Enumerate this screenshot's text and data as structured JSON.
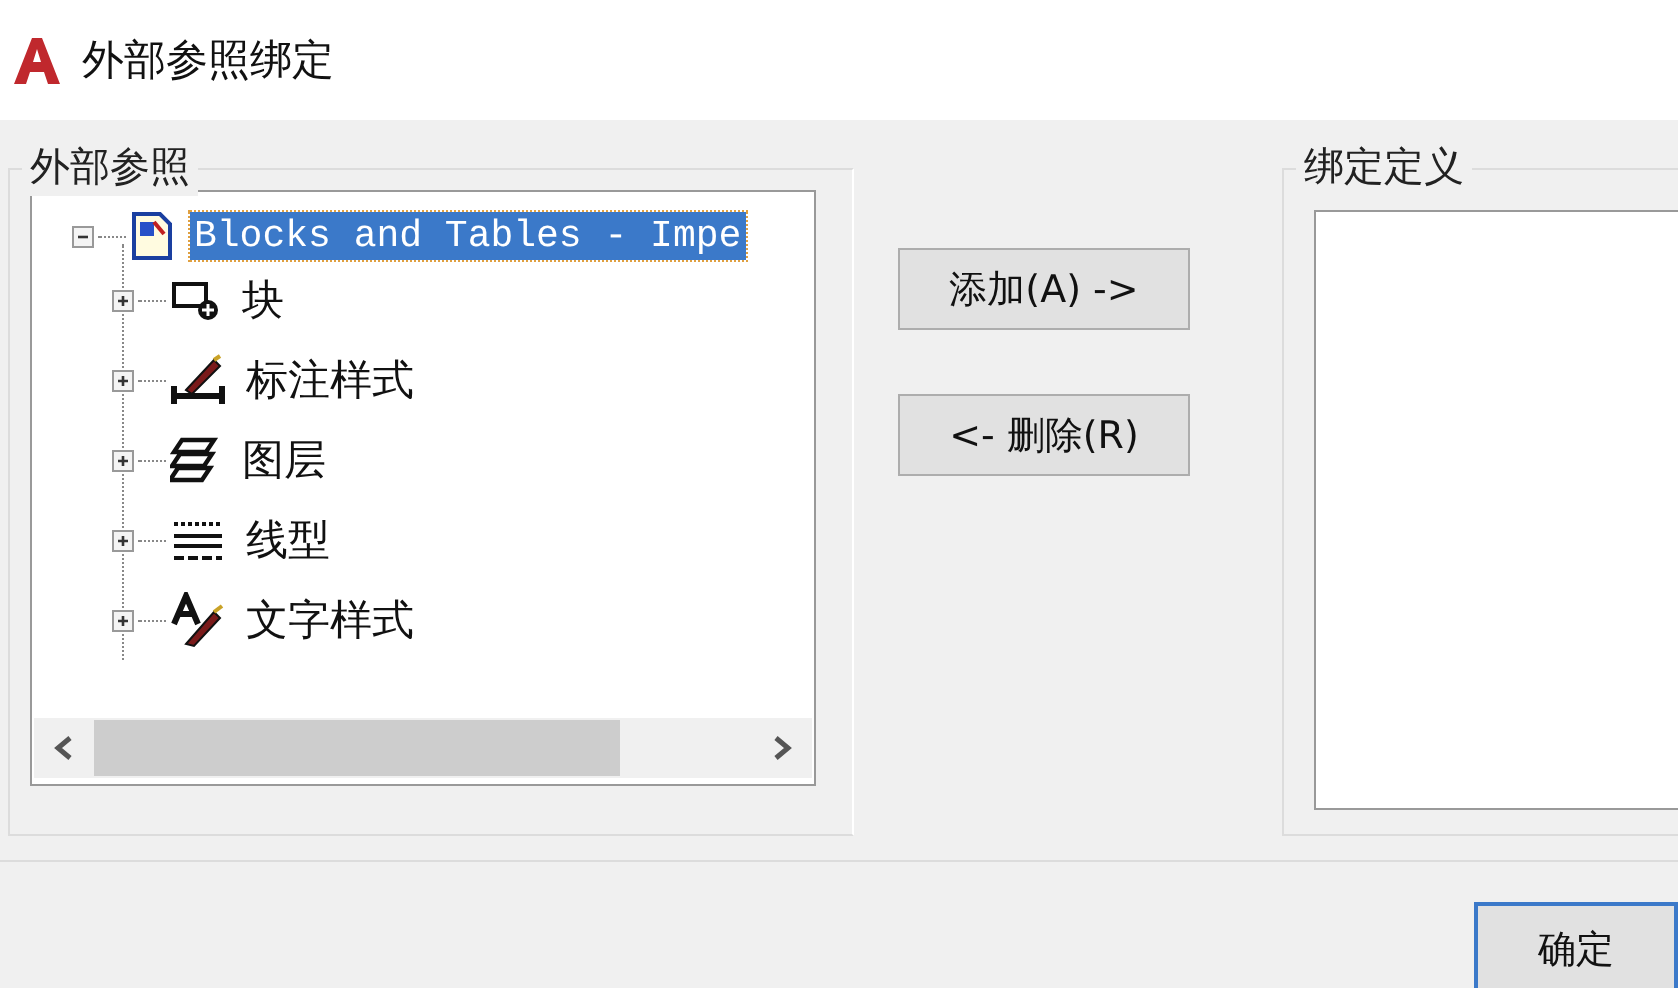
{
  "window": {
    "title": "外部参照绑定"
  },
  "xrefs": {
    "label": "外部参照",
    "tree": {
      "label": "Blocks and Tables - Impe",
      "expanded": true,
      "selected": true,
      "children": [
        {
          "label": "块",
          "kind": "block",
          "expanded": false,
          "selected": false
        },
        {
          "label": "标注样式",
          "kind": "dimstyle",
          "expanded": false,
          "selected": false
        },
        {
          "label": "图层",
          "kind": "layer",
          "expanded": false,
          "selected": false
        },
        {
          "label": "线型",
          "kind": "linetype",
          "expanded": false,
          "selected": false
        },
        {
          "label": "文字样式",
          "kind": "textstyle",
          "expanded": false,
          "selected": false
        }
      ]
    }
  },
  "actions": [
    "添加(A) ->",
    "<- 删除(R)"
  ],
  "definitions": {
    "label": "绑定定义"
  },
  "buttons": [
    "确定"
  ]
}
